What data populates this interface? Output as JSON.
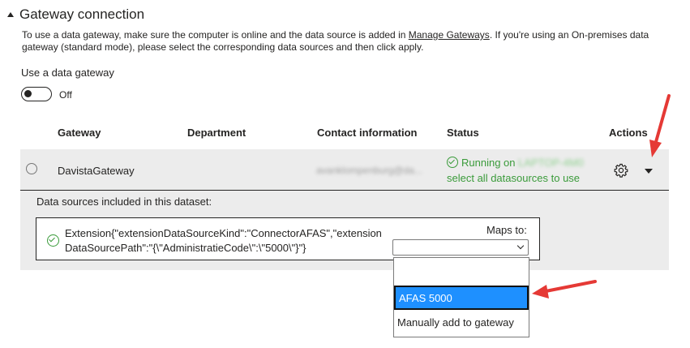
{
  "section": {
    "title": "Gateway connection"
  },
  "intro": {
    "part1": "To use a data gateway, make sure the computer is online and the data source is added in ",
    "link": "Manage Gateways",
    "part2": ". If you're using an On-premises data gateway (standard mode), please select the corresponding data sources and then click apply."
  },
  "use_gateway": {
    "label": "Use a data gateway",
    "state": "Off"
  },
  "table": {
    "headers": {
      "gateway": "Gateway",
      "department": "Department",
      "contact": "Contact information",
      "status": "Status",
      "actions": "Actions"
    },
    "row": {
      "gateway": "DavistaGateway",
      "department": "",
      "contact": "avanklompenburg@da...",
      "status_prefix": "Running on",
      "status_machine": "LAPTOP-4M0",
      "status_link": "select all datasources to use"
    }
  },
  "datasources": {
    "label": "Data sources included in this dataset:",
    "item": "Extension{\"extensionDataSourceKind\":\"ConnectorAFAS\",\"extensionDataSourcePath\":\"{\\\"AdministratieCode\\\":\\\"5000\\\"}\"}",
    "maps_to_label": "Maps to:",
    "select_value": "",
    "options": [
      "",
      "AFAS 5000",
      "Manually add to gateway"
    ]
  },
  "colors": {
    "status_green": "#3a9b3a",
    "highlight": "#1e90ff",
    "annotation_arrow": "#e53935"
  }
}
